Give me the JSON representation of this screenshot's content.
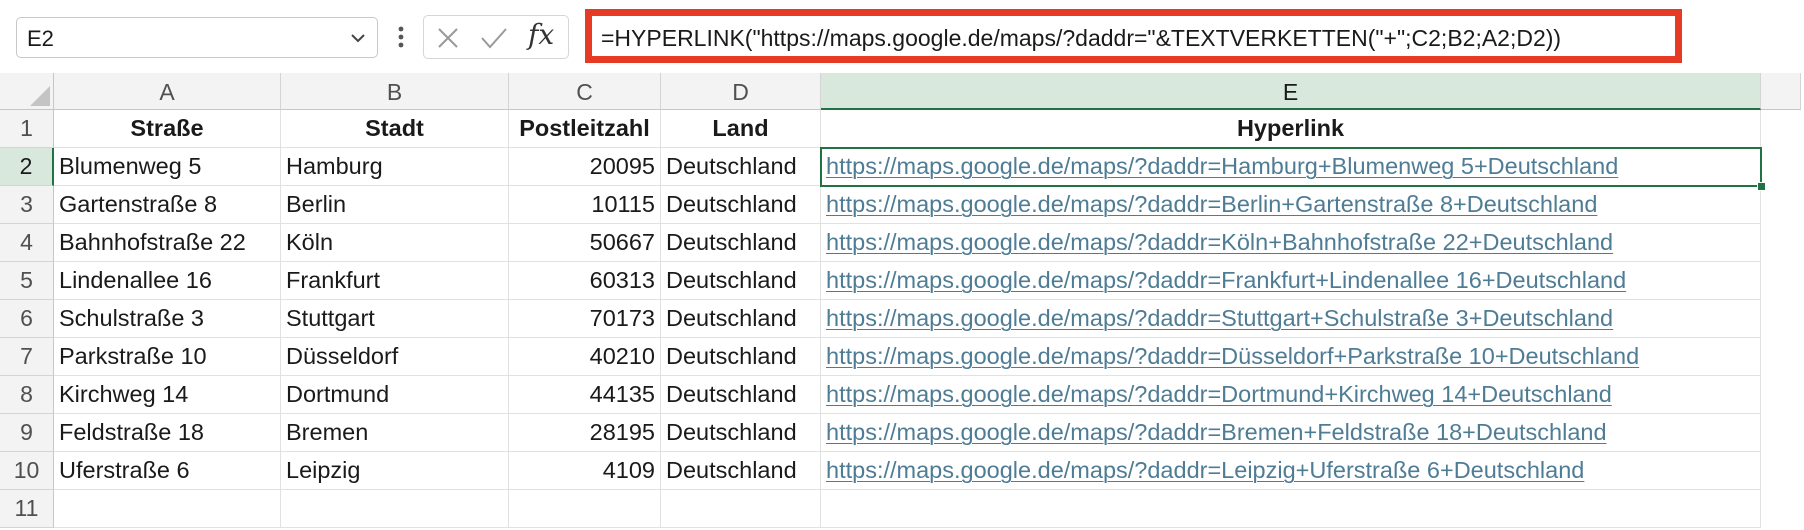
{
  "formula_bar": {
    "name_box": "E2",
    "formula": "=HYPERLINK(\"https://maps.google.de/maps/?daddr=\"&TEXTVERKETTEN(\"+\";C2;B2;A2;D2))",
    "icons": [
      "chevron-down-icon",
      "kebab-icon",
      "cancel-icon",
      "enter-icon",
      "insert-function-icon"
    ],
    "highlight_color": "#e53a24"
  },
  "grid": {
    "columns": [
      "A",
      "B",
      "C",
      "D",
      "E"
    ],
    "row_numbers": [
      "1",
      "2",
      "3",
      "4",
      "5",
      "6",
      "7",
      "8",
      "9",
      "10",
      "11"
    ],
    "selected_column": "E",
    "selected_row": "2",
    "headers": [
      "Straße",
      "Stadt",
      "Postleitzahl",
      "Land",
      "Hyperlink"
    ],
    "rows": [
      [
        "Blumenweg 5",
        "Hamburg",
        "20095",
        "Deutschland",
        "https://maps.google.de/maps/?daddr=Hamburg+Blumenweg 5+Deutschland"
      ],
      [
        "Gartenstraße 8",
        "Berlin",
        "10115",
        "Deutschland",
        "https://maps.google.de/maps/?daddr=Berlin+Gartenstraße 8+Deutschland"
      ],
      [
        "Bahnhofstraße 22",
        "Köln",
        "50667",
        "Deutschland",
        "https://maps.google.de/maps/?daddr=Köln+Bahnhofstraße 22+Deutschland"
      ],
      [
        "Lindenallee 16",
        "Frankfurt",
        "60313",
        "Deutschland",
        "https://maps.google.de/maps/?daddr=Frankfurt+Lindenallee 16+Deutschland"
      ],
      [
        "Schulstraße 3",
        "Stuttgart",
        "70173",
        "Deutschland",
        "https://maps.google.de/maps/?daddr=Stuttgart+Schulstraße 3+Deutschland"
      ],
      [
        "Parkstraße 10",
        "Düsseldorf",
        "40210",
        "Deutschland",
        "https://maps.google.de/maps/?daddr=Düsseldorf+Parkstraße 10+Deutschland"
      ],
      [
        "Kirchweg 14",
        "Dortmund",
        "44135",
        "Deutschland",
        "https://maps.google.de/maps/?daddr=Dortmund+Kirchweg 14+Deutschland"
      ],
      [
        "Feldstraße 18",
        "Bremen",
        "28195",
        "Deutschland",
        "https://maps.google.de/maps/?daddr=Bremen+Feldstraße 18+Deutschland"
      ],
      [
        "Uferstraße 6",
        "Leipzig",
        "4109",
        "Deutschland",
        "https://maps.google.de/maps/?daddr=Leipzig+Uferstraße 6+Deutschland"
      ]
    ],
    "link_color": "#4f7c95",
    "selection_color": "#217346"
  }
}
